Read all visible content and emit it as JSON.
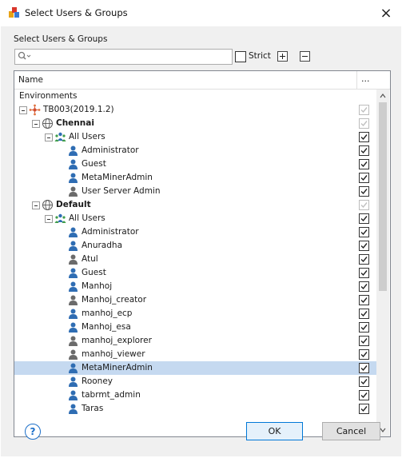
{
  "window": {
    "title": "Select Users & Groups"
  },
  "group_label": "Select Users & Groups",
  "search": {
    "value": "",
    "placeholder": ""
  },
  "strict": {
    "label": "Strict",
    "checked": false
  },
  "grid": {
    "header_name": "Name",
    "header_more": "...",
    "rows": [
      {
        "label": "Environments",
        "level": 0,
        "type": "heading",
        "expander": false,
        "checkbox": "none"
      },
      {
        "label": "TB003(2019.1.2)",
        "level": 0,
        "type": "environment",
        "expander": true,
        "checkbox": "disabled"
      },
      {
        "label": "Chennai",
        "level": 1,
        "type": "globe",
        "bold": true,
        "expander": true,
        "checkbox": "disabled"
      },
      {
        "label": "All Users",
        "level": 2,
        "type": "group",
        "expander": true,
        "checkbox": "checked"
      },
      {
        "label": "Administrator",
        "level": 3,
        "type": "user-blue",
        "checkbox": "checked"
      },
      {
        "label": "Guest",
        "level": 3,
        "type": "user-blue",
        "checkbox": "checked"
      },
      {
        "label": "MetaMinerAdmin",
        "level": 3,
        "type": "user-blue",
        "checkbox": "checked"
      },
      {
        "label": "User Server Admin",
        "level": 3,
        "type": "user-gray",
        "checkbox": "checked"
      },
      {
        "label": "Default",
        "level": 1,
        "type": "globe",
        "bold": true,
        "expander": true,
        "checkbox": "disabled"
      },
      {
        "label": "All Users",
        "level": 2,
        "type": "group",
        "expander": true,
        "checkbox": "checked"
      },
      {
        "label": "Administrator",
        "level": 3,
        "type": "user-blue",
        "checkbox": "checked"
      },
      {
        "label": "Anuradha",
        "level": 3,
        "type": "user-blue",
        "checkbox": "checked"
      },
      {
        "label": "Atul",
        "level": 3,
        "type": "user-gray",
        "checkbox": "checked"
      },
      {
        "label": "Guest",
        "level": 3,
        "type": "user-blue",
        "checkbox": "checked"
      },
      {
        "label": "Manhoj",
        "level": 3,
        "type": "user-blue",
        "checkbox": "checked"
      },
      {
        "label": "Manhoj_creator",
        "level": 3,
        "type": "user-gray",
        "checkbox": "checked"
      },
      {
        "label": "manhoj_ecp",
        "level": 3,
        "type": "user-blue",
        "checkbox": "checked"
      },
      {
        "label": "Manhoj_esa",
        "level": 3,
        "type": "user-blue",
        "checkbox": "checked"
      },
      {
        "label": "manhoj_explorer",
        "level": 3,
        "type": "user-gray",
        "checkbox": "checked"
      },
      {
        "label": "manhoj_viewer",
        "level": 3,
        "type": "user-gray",
        "checkbox": "checked"
      },
      {
        "label": "MetaMinerAdmin",
        "level": 3,
        "type": "user-blue",
        "checkbox": "checked",
        "selected": true
      },
      {
        "label": "Rooney",
        "level": 3,
        "type": "user-blue",
        "checkbox": "checked"
      },
      {
        "label": "tabrmt_admin",
        "level": 3,
        "type": "user-blue",
        "checkbox": "checked"
      },
      {
        "label": "Taras",
        "level": 3,
        "type": "user-blue",
        "checkbox": "checked"
      }
    ]
  },
  "buttons": {
    "ok": "OK",
    "cancel": "Cancel",
    "help": "?"
  },
  "colors": {
    "selection": "#c5d9f0",
    "user_blue": "#2f6db3",
    "user_gray": "#6b6b6b",
    "accent": "#0078d7"
  }
}
